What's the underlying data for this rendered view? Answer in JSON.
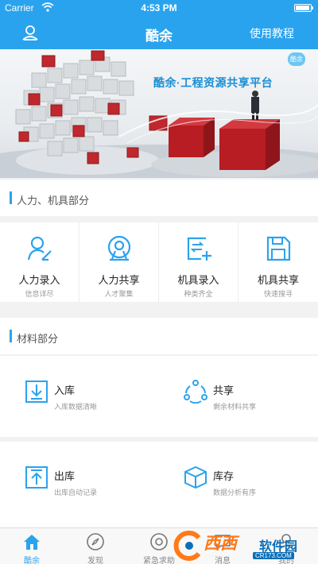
{
  "status": {
    "carrier": "Carrier",
    "time": "4:53 PM"
  },
  "nav": {
    "title": "酷余",
    "help": "使用教程",
    "left_icon": "user-icon"
  },
  "banner": {
    "text": "酷余·工程资源共享平台",
    "badge": "酷余"
  },
  "sections": {
    "labor": "人力、机具部分",
    "materials": "材料部分"
  },
  "labor_items": [
    {
      "title": "人力录入",
      "subtitle": "信息详尽",
      "icon": "person-edit-icon"
    },
    {
      "title": "人力共享",
      "subtitle": "人才聚集",
      "icon": "person-share-icon"
    },
    {
      "title": "机具录入",
      "subtitle": "种类齐全",
      "icon": "machine-add-icon"
    },
    {
      "title": "机具共享",
      "subtitle": "快速搜寻",
      "icon": "save-icon"
    }
  ],
  "material_items": [
    {
      "title": "入库",
      "subtitle": "入库数据清晰",
      "icon": "download-box-icon"
    },
    {
      "title": "共享",
      "subtitle": "剩余材料共享",
      "icon": "share-nodes-icon"
    },
    {
      "title": "出库",
      "subtitle": "出库自动记录",
      "icon": "upload-box-icon"
    },
    {
      "title": "库存",
      "subtitle": "数据分析有序",
      "icon": "cube-icon"
    }
  ],
  "tabs": [
    {
      "label": "酷余",
      "icon": "home-icon",
      "active": true
    },
    {
      "label": "发现",
      "icon": "compass-icon",
      "active": false
    },
    {
      "label": "紧急求助",
      "icon": "help-icon",
      "active": false
    },
    {
      "label": "消息",
      "icon": "message-icon",
      "active": false
    },
    {
      "label": "我的",
      "icon": "profile-icon",
      "active": false
    }
  ],
  "watermark": {
    "brand": "西西",
    "sub": "软件园",
    "url": "CR173.COM"
  },
  "colors": {
    "accent": "#2aa3ee",
    "text": "#222222",
    "muted": "#999999"
  }
}
